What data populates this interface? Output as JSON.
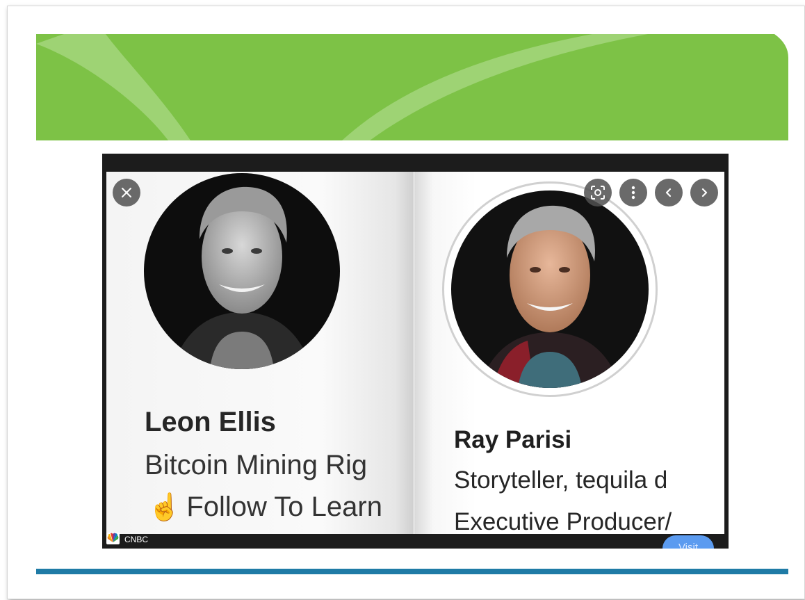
{
  "viewer": {
    "source_name": "CNBC",
    "visit_label": "Visit"
  },
  "profile_left": {
    "name": "Leon Ellis",
    "bio_line1": "Bitcoin Mining Rig",
    "bio_emoji": "☝",
    "bio_line2": "Follow To Learn"
  },
  "profile_right": {
    "name": "Ray Parisi",
    "bio_line1": "Storyteller, tequila d",
    "bio_line2": "Executive Producer/"
  },
  "icons": {
    "close": "close-icon",
    "lens": "lens-icon",
    "more": "more-vert-icon",
    "prev": "chevron-left-icon",
    "next": "chevron-right-icon"
  },
  "colors": {
    "banner_green": "#7dc246",
    "footer_blue": "#1f7ba6",
    "visit_blue": "#5b9bf0",
    "viewer_bg": "#1c1c1c"
  }
}
